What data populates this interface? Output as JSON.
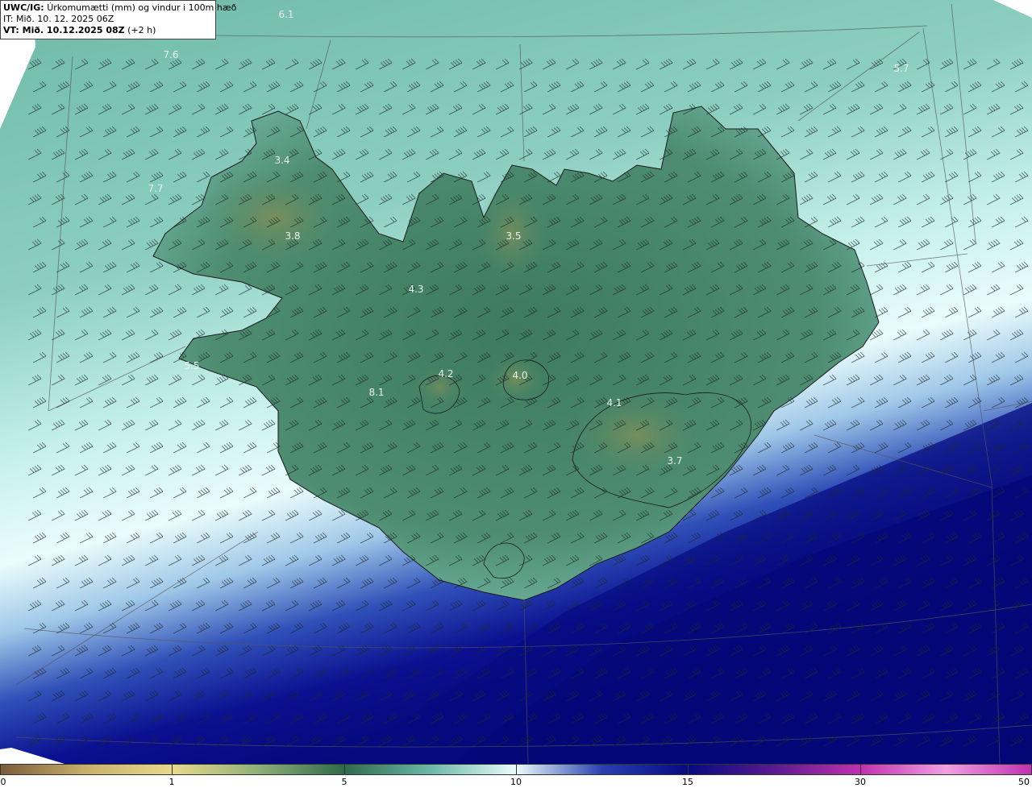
{
  "title": {
    "prefix": "UWC/IG:",
    "text": "Úrkomumætti (mm) og vindur i 100m hæð",
    "issue": "IT: Mið. 10. 12. 2025 06Z",
    "valid": "VT: Mið. 10.12.2025 08Z",
    "valid_offset": " (+2 h)"
  },
  "point_values": [
    {
      "label": "6.1"
    },
    {
      "label": "7.6"
    },
    {
      "label": "5.7"
    },
    {
      "label": "3.4"
    },
    {
      "label": "7.7"
    },
    {
      "label": "3.8"
    },
    {
      "label": "3.5"
    },
    {
      "label": "4.3"
    },
    {
      "label": "5.5"
    },
    {
      "label": "4.2"
    },
    {
      "label": "4.0"
    },
    {
      "label": "8.1"
    },
    {
      "label": "4.1"
    },
    {
      "label": "3.7"
    }
  ],
  "colorbar": {
    "ticks": [
      {
        "label": "0",
        "value": 0
      },
      {
        "label": "1",
        "value": 1
      },
      {
        "label": "5",
        "value": 5
      },
      {
        "label": "10",
        "value": 10
      },
      {
        "label": "15",
        "value": 15
      },
      {
        "label": "30",
        "value": 30
      },
      {
        "label": "50",
        "value": 50
      }
    ],
    "colors": {
      "brown": "#7a5a3a",
      "tan": "#c9b06a",
      "yellow": "#e8d98a",
      "green_light": "#8fb07a",
      "green_dark": "#2f6a4a",
      "teal": "#6ab8a8",
      "aqua": "#b8ece6",
      "white": "#eafcfc",
      "blue": "#2a40b0",
      "navy": "#050a80",
      "purple": "#5a1a90",
      "magenta": "#c030b0",
      "pink": "#f0a0e0"
    }
  },
  "colors": {
    "land_green": "#4f8f72",
    "sea_teal": "#7cc4b4",
    "coast_line": "#1a1a1a",
    "navy": "#06097c"
  }
}
